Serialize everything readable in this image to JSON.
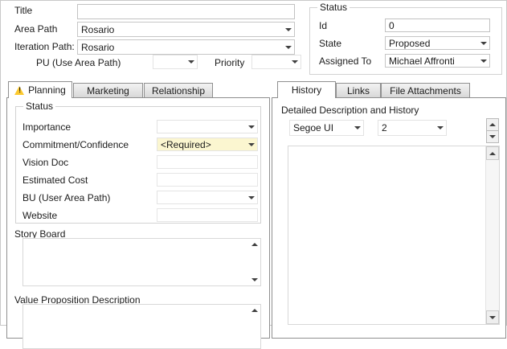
{
  "header": {
    "title": {
      "label": "Title",
      "value": ""
    },
    "area_path": {
      "label": "Area Path",
      "value": "Rosario"
    },
    "iteration_path": {
      "label": "Iteration Path:",
      "value": "Rosario"
    },
    "pu": {
      "label": "PU (Use Area Path)",
      "value": ""
    },
    "priority": {
      "label": "Priority",
      "value": ""
    },
    "status_group": {
      "caption": "Status",
      "id": {
        "label": "Id",
        "value": "0"
      },
      "state": {
        "label": "State",
        "value": "Proposed"
      },
      "assigned_to": {
        "label": "Assigned To",
        "value": "Michael Affronti"
      }
    }
  },
  "planning": {
    "tab_labels": {
      "planning": "Planning",
      "marketing": "Marketing",
      "relationship": "Relationship"
    },
    "group_caption": "Status",
    "fields": [
      {
        "label": "Importance",
        "value": ""
      },
      {
        "label": "Commitment/Confidence",
        "value": "<Required>"
      },
      {
        "label": "Vision Doc",
        "value": ""
      },
      {
        "label": "Estimated Cost",
        "value": ""
      },
      {
        "label": "BU (User Area Path)",
        "value": ""
      },
      {
        "label": "Website",
        "value": ""
      }
    ],
    "story_board_label": "Story Board",
    "value_proposition_label": "Value Proposition Description"
  },
  "history": {
    "tab_labels": {
      "history": "History",
      "links": "Links",
      "file_attachments": "File Attachments"
    },
    "detail_label": "Detailed Description and History",
    "font_name": "Segoe UI",
    "font_size": "2",
    "editor_text": ""
  },
  "icons": {
    "warning": "warning-triangle",
    "combo_arrow": "chevron-down",
    "scroll_up": "triangle-up",
    "scroll_down": "triangle-down"
  },
  "colors": {
    "required_field_bg": "#fbf6d0",
    "warning_yellow": "#fcc92e",
    "tab_border": "#8f8f8f"
  }
}
